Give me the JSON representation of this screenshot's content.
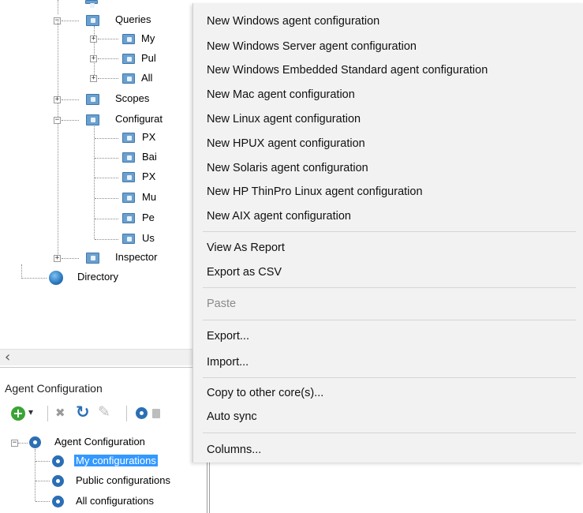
{
  "tree_top": {
    "items": [
      {
        "label": "Queries"
      },
      {
        "label": "My"
      },
      {
        "label": "Pul"
      },
      {
        "label": "All"
      },
      {
        "label": "Scopes"
      },
      {
        "label": "Configurat"
      },
      {
        "label": "PX"
      },
      {
        "label": "Bai"
      },
      {
        "label": "PX"
      },
      {
        "label": "Mu"
      },
      {
        "label": "Pe"
      },
      {
        "label": "Us"
      },
      {
        "label": "Inspector"
      },
      {
        "label": "Directory"
      }
    ],
    "expand_plus": "+",
    "expand_minus": "−"
  },
  "context_menu": {
    "items": [
      {
        "label": "New Windows agent configuration"
      },
      {
        "label": "New Windows Server agent configuration"
      },
      {
        "label": "New Windows Embedded Standard agent configuration"
      },
      {
        "label": "New Mac agent configuration"
      },
      {
        "label": "New Linux agent configuration"
      },
      {
        "label": "New HPUX agent configuration"
      },
      {
        "label": "New Solaris agent configuration"
      },
      {
        "label": "New HP ThinPro Linux agent configuration"
      },
      {
        "label": "New AIX agent configuration"
      },
      {
        "label": "View As Report"
      },
      {
        "label": "Export as CSV"
      },
      {
        "label": "Paste"
      },
      {
        "label": "Export..."
      },
      {
        "label": "Import..."
      },
      {
        "label": "Copy to other core(s)..."
      },
      {
        "label": "Auto sync"
      },
      {
        "label": "Columns..."
      }
    ]
  },
  "scrollbar": {
    "left_arrow": "‹"
  },
  "panel": {
    "title": "Agent Configuration",
    "toolbar": {
      "add_icon": "add-icon",
      "dropdown_glyph": "▾",
      "delete_glyph": "✖",
      "refresh_glyph": "↻",
      "edit_glyph": "✎"
    },
    "tree": {
      "root": "Agent Configuration",
      "children": [
        {
          "label": "My configurations"
        },
        {
          "label": "Public configurations"
        },
        {
          "label": "All configurations"
        }
      ]
    }
  },
  "colors": {
    "selection": "#3399ff",
    "menu_bg": "#f2f2f2",
    "disabled_text": "#8a8a8a",
    "icon_blue": "#2b6fb5",
    "add_green": "#3aa335"
  }
}
